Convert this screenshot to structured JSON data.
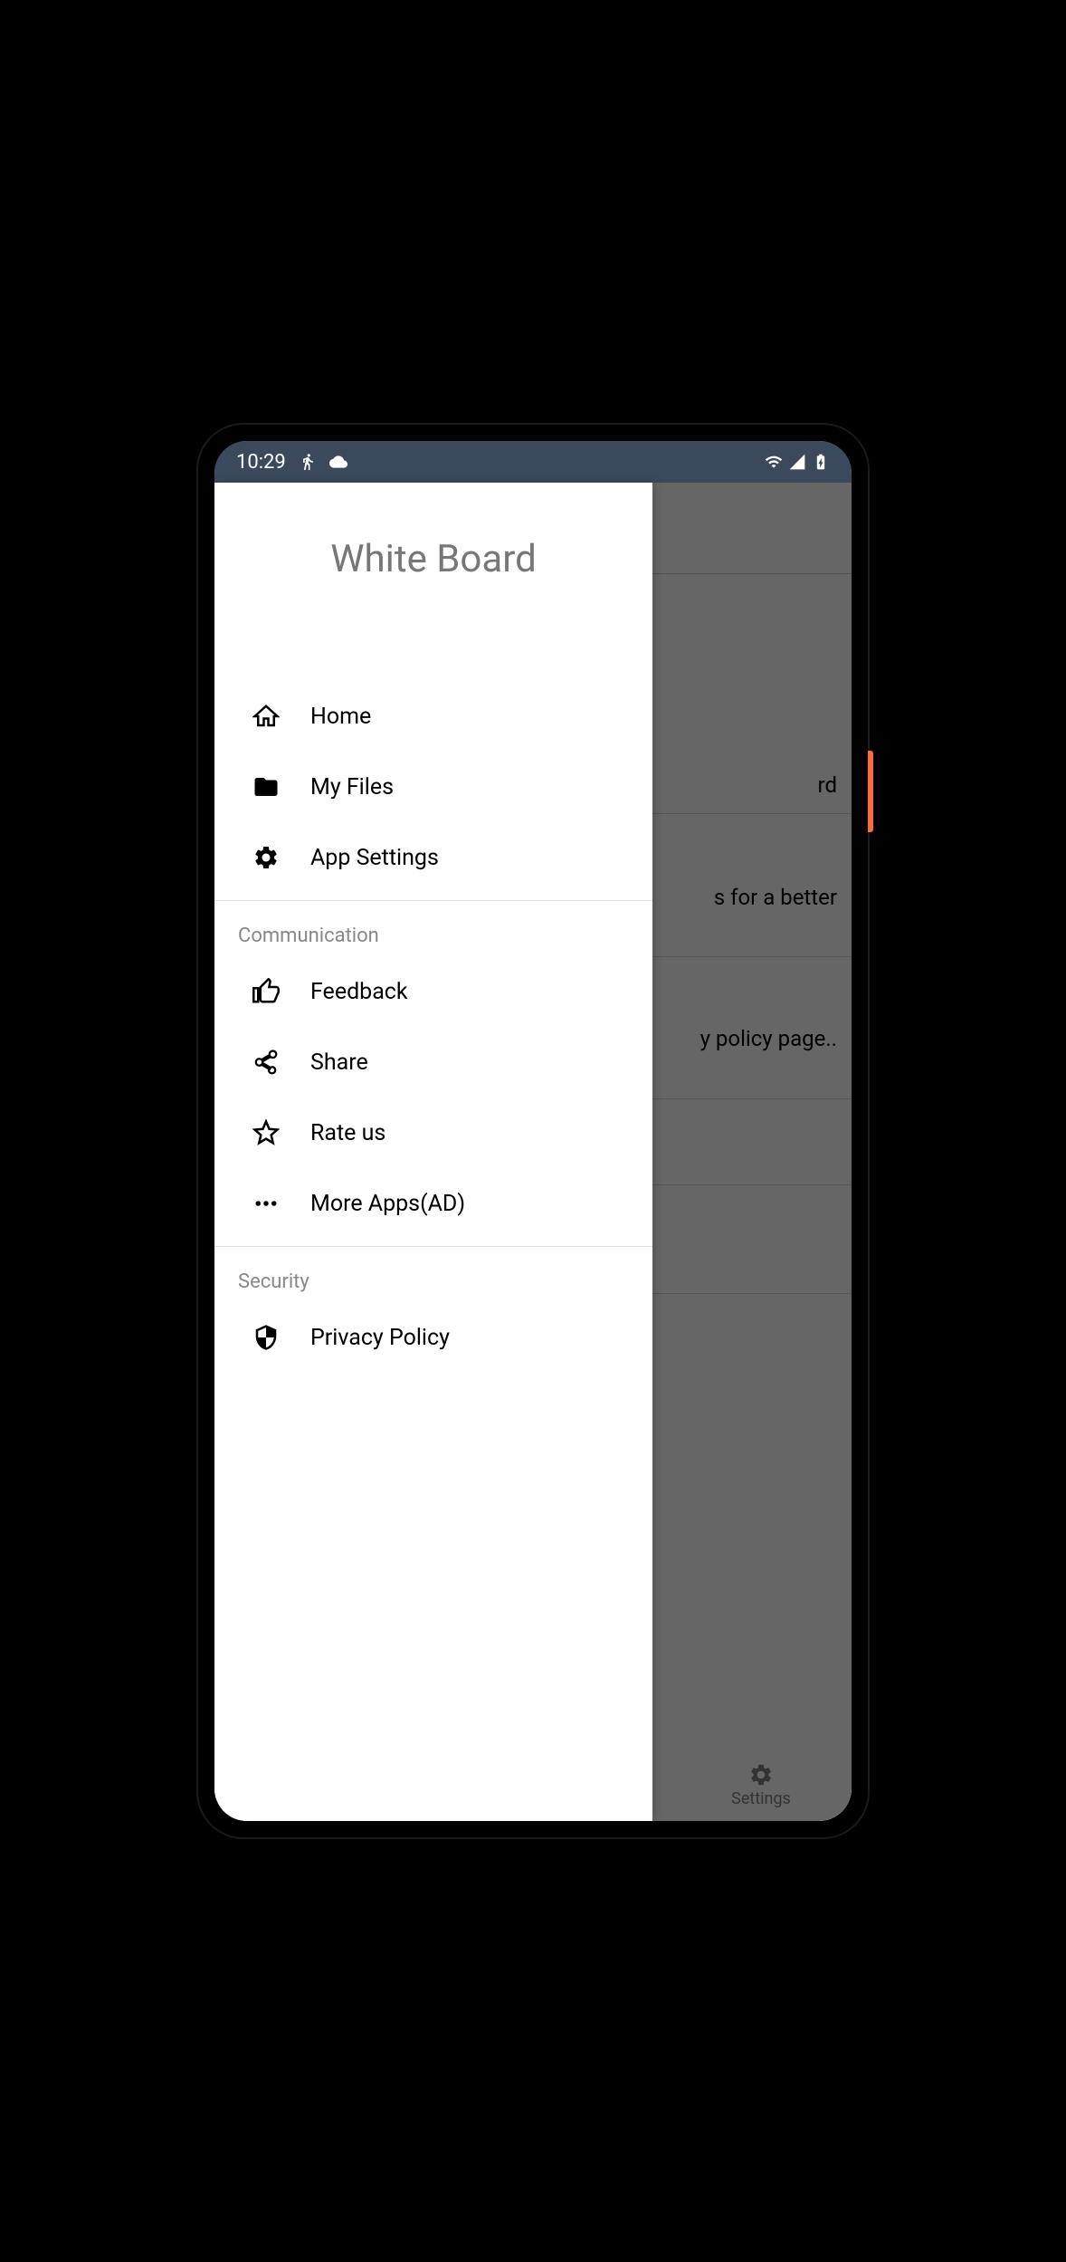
{
  "status_bar": {
    "time": "10:29"
  },
  "drawer": {
    "title": "White Board",
    "main_items": [
      {
        "label": "Home"
      },
      {
        "label": "My Files"
      },
      {
        "label": "App Settings"
      }
    ],
    "section_communication": {
      "title": "Communication",
      "items": [
        {
          "label": "Feedback"
        },
        {
          "label": "Share"
        },
        {
          "label": "Rate us"
        },
        {
          "label": "More Apps(AD)"
        }
      ]
    },
    "section_security": {
      "title": "Security",
      "items": [
        {
          "label": "Privacy Policy"
        }
      ]
    }
  },
  "background": {
    "text1": "rd",
    "text2": "s for a better",
    "text3": "y policy page.."
  },
  "bottom_nav": {
    "settings_label": "Settings"
  }
}
